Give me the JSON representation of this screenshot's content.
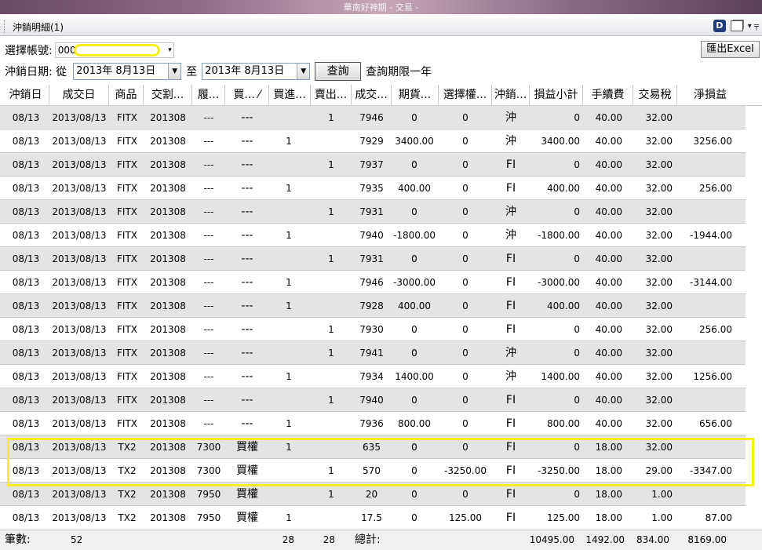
{
  "window": {
    "title": "華南好神期 - 交易 -"
  },
  "panel": {
    "title": "沖銷明細(1)",
    "pin_glyph": "▾ ╤"
  },
  "account": {
    "label": "選擇帳號:",
    "value": "000-",
    "arrow": "▾"
  },
  "export_button": "匯出Excel",
  "date_query": {
    "label": "沖銷日期: 從",
    "from": "2013年  8月13日",
    "to_label": "至",
    "to": "2013年  8月13日",
    "dropdown": "▼",
    "button": "查詢",
    "note": "查詢期限一年"
  },
  "columns": [
    "沖銷日",
    "成交日",
    "商品",
    "交割...",
    "履...",
    "買... ⁄",
    "買進...",
    "賣出...",
    "成交...",
    "期貨...",
    "選擇權...",
    "沖銷...",
    "損益小計",
    "手續費",
    "交易稅",
    "淨損益"
  ],
  "rows": [
    [
      "08/13",
      "2013/08/13",
      "FITX",
      "201308",
      "---",
      "---",
      "",
      "1",
      "7946",
      "0",
      "0",
      "沖",
      "0",
      "40.00",
      "32.00",
      ""
    ],
    [
      "08/13",
      "2013/08/13",
      "FITX",
      "201308",
      "---",
      "---",
      "1",
      "",
      "7929",
      "3400.00",
      "0",
      "沖",
      "3400.00",
      "40.00",
      "32.00",
      "3256.00"
    ],
    [
      "08/13",
      "2013/08/13",
      "FITX",
      "201308",
      "---",
      "---",
      "",
      "1",
      "7937",
      "0",
      "0",
      "FI",
      "0",
      "40.00",
      "32.00",
      ""
    ],
    [
      "08/13",
      "2013/08/13",
      "FITX",
      "201308",
      "---",
      "---",
      "1",
      "",
      "7935",
      "400.00",
      "0",
      "FI",
      "400.00",
      "40.00",
      "32.00",
      "256.00"
    ],
    [
      "08/13",
      "2013/08/13",
      "FITX",
      "201308",
      "---",
      "---",
      "",
      "1",
      "7931",
      "0",
      "0",
      "沖",
      "0",
      "40.00",
      "32.00",
      ""
    ],
    [
      "08/13",
      "2013/08/13",
      "FITX",
      "201308",
      "---",
      "---",
      "1",
      "",
      "7940",
      "-1800.00",
      "0",
      "沖",
      "-1800.00",
      "40.00",
      "32.00",
      "-1944.00"
    ],
    [
      "08/13",
      "2013/08/13",
      "FITX",
      "201308",
      "---",
      "---",
      "",
      "1",
      "7931",
      "0",
      "0",
      "FI",
      "0",
      "40.00",
      "32.00",
      ""
    ],
    [
      "08/13",
      "2013/08/13",
      "FITX",
      "201308",
      "---",
      "---",
      "1",
      "",
      "7946",
      "-3000.00",
      "0",
      "FI",
      "-3000.00",
      "40.00",
      "32.00",
      "-3144.00"
    ],
    [
      "08/13",
      "2013/08/13",
      "FITX",
      "201308",
      "---",
      "---",
      "1",
      "",
      "7928",
      "400.00",
      "0",
      "FI",
      "400.00",
      "40.00",
      "32.00",
      ""
    ],
    [
      "08/13",
      "2013/08/13",
      "FITX",
      "201308",
      "---",
      "---",
      "",
      "1",
      "7930",
      "0",
      "0",
      "FI",
      "0",
      "40.00",
      "32.00",
      "256.00"
    ],
    [
      "08/13",
      "2013/08/13",
      "FITX",
      "201308",
      "---",
      "---",
      "",
      "1",
      "7941",
      "0",
      "0",
      "沖",
      "0",
      "40.00",
      "32.00",
      ""
    ],
    [
      "08/13",
      "2013/08/13",
      "FITX",
      "201308",
      "---",
      "---",
      "1",
      "",
      "7934",
      "1400.00",
      "0",
      "沖",
      "1400.00",
      "40.00",
      "32.00",
      "1256.00"
    ],
    [
      "08/13",
      "2013/08/13",
      "FITX",
      "201308",
      "---",
      "---",
      "",
      "1",
      "7940",
      "0",
      "0",
      "FI",
      "0",
      "40.00",
      "32.00",
      ""
    ],
    [
      "08/13",
      "2013/08/13",
      "FITX",
      "201308",
      "---",
      "---",
      "1",
      "",
      "7936",
      "800.00",
      "0",
      "FI",
      "800.00",
      "40.00",
      "32.00",
      "656.00"
    ],
    [
      "08/13",
      "2013/08/13",
      "TX2",
      "201308",
      "7300",
      "買權",
      "1",
      "",
      "635",
      "0",
      "0",
      "FI",
      "0",
      "18.00",
      "32.00",
      ""
    ],
    [
      "08/13",
      "2013/08/13",
      "TX2",
      "201308",
      "7300",
      "買權",
      "",
      "1",
      "570",
      "0",
      "-3250.00",
      "FI",
      "-3250.00",
      "18.00",
      "29.00",
      "-3347.00"
    ],
    [
      "08/13",
      "2013/08/13",
      "TX2",
      "201308",
      "7950",
      "買權",
      "",
      "1",
      "20",
      "0",
      "0",
      "FI",
      "0",
      "18.00",
      "1.00",
      ""
    ],
    [
      "08/13",
      "2013/08/13",
      "TX2",
      "201308",
      "7950",
      "買權",
      "1",
      "",
      "17.5",
      "0",
      "125.00",
      "FI",
      "125.00",
      "18.00",
      "1.00",
      "87.00"
    ]
  ],
  "footer": {
    "count_label": "筆數:",
    "count": "52",
    "buy_total": "28",
    "sell_total": "28",
    "total_label": "總計:",
    "pl_total": "10495.00",
    "fee_total": "1492.00",
    "tax_total": "834.00",
    "net_total": "8169.00"
  },
  "colors": {
    "highlight": "#f6ee1f",
    "row_gray": "#e4e4e4",
    "titlebar": "#8d6a86"
  }
}
